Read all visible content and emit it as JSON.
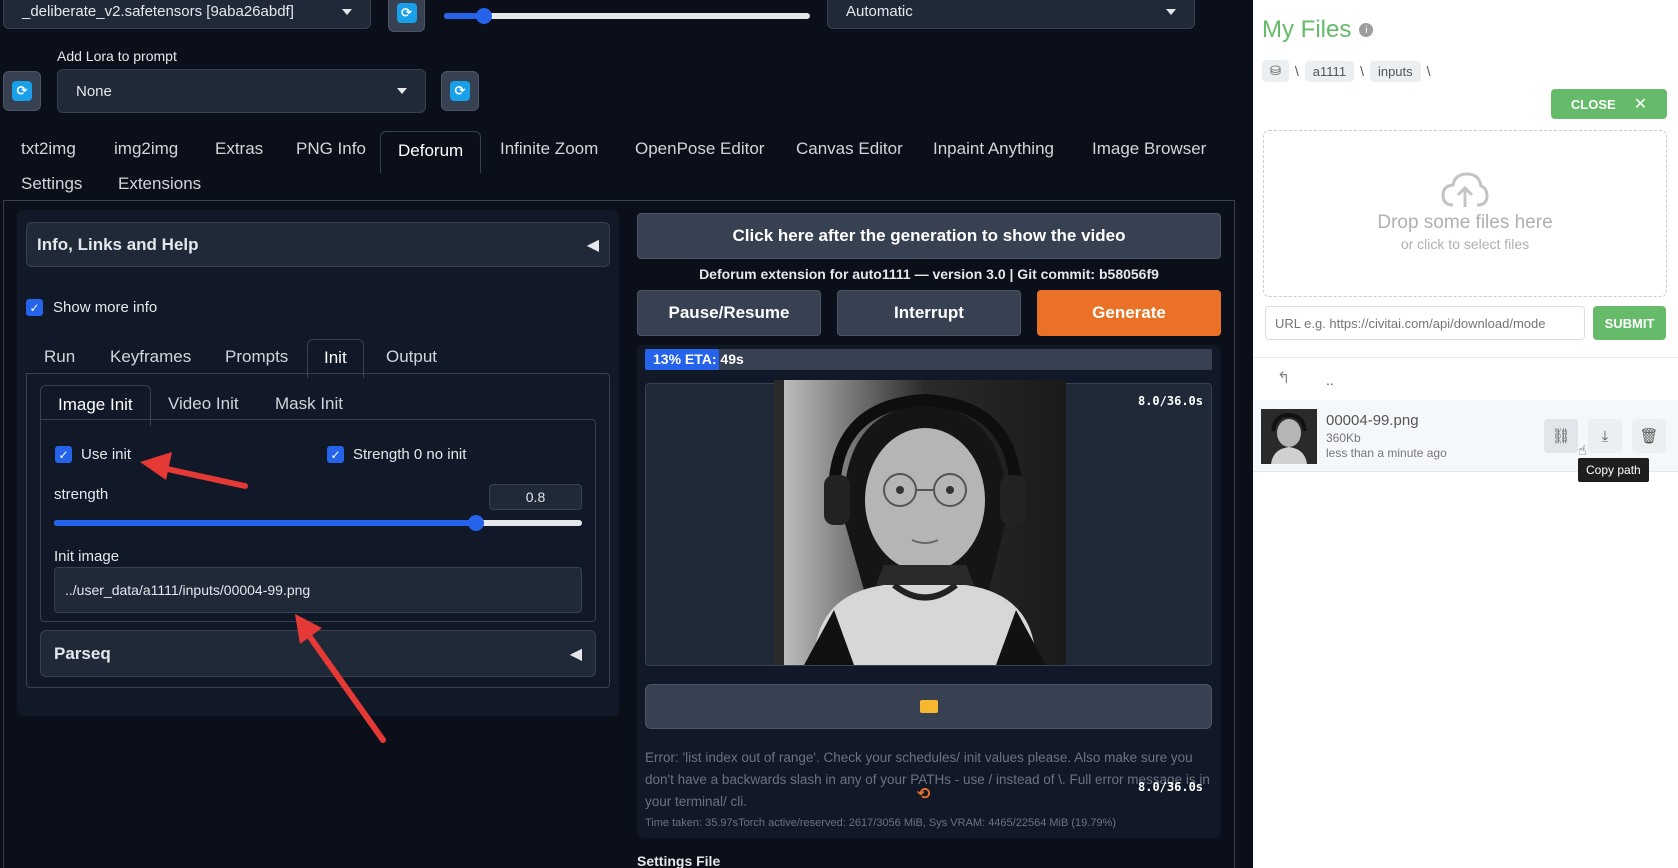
{
  "top": {
    "checkpoint": "_deliberate_v2.safetensors [9aba26abdf]",
    "vae_select": "Automatic",
    "lora_label": "Add Lora to prompt",
    "lora_value": "None"
  },
  "main_tabs": [
    "txt2img",
    "img2img",
    "Extras",
    "PNG Info",
    "Deforum",
    "Infinite Zoom",
    "OpenPose Editor",
    "Canvas Editor",
    "Inpaint Anything",
    "Image Browser",
    "Settings",
    "Extensions"
  ],
  "left": {
    "accordion_info": "Info, Links and Help",
    "show_more_info": "Show more info",
    "sub_tabs": [
      "Run",
      "Keyframes",
      "Prompts",
      "Init",
      "Output"
    ],
    "init_tabs": [
      "Image Init",
      "Video Init",
      "Mask Init"
    ],
    "use_init": "Use init",
    "strength_0": "Strength 0 no init",
    "strength_label": "strength",
    "strength_value": "0.8",
    "strength_fraction": 0.8,
    "init_image_label": "Init image",
    "init_image_value": "../user_data/a1111/inputs/00004-99.png",
    "parseq": "Parseq"
  },
  "center": {
    "show_video_btn": "Click here after the generation to show the video",
    "version_line": "Deforum extension for auto1111 — version 3.0 | Git commit: b58056f9",
    "pause_btn": "Pause/Resume",
    "interrupt_btn": "Interrupt",
    "generate_btn": "Generate",
    "progress_text": "13% ETA: 49s",
    "progress_fraction": 0.13,
    "frame_counter": "8.0/36.0s",
    "frame_counter2": "8.0/36.0s",
    "error_text": "Error: 'list index out of range'. Check your schedules/ init values please. Also make sure you don't have a backwards slash in any of your PATHs - use / instead of \\. Full error message is in your terminal/ cli.",
    "time_taken": "Time taken: 35.97sTorch active/reserved: 2617/3056 MiB, Sys VRAM: 4465/22564 MiB (19.79%)",
    "settings_file": "Settings File"
  },
  "files": {
    "title": "My Files",
    "crumbs": [
      "a1111",
      "inputs"
    ],
    "close_btn": "CLOSE",
    "drop_title": "Drop some files here",
    "drop_sub": "or click to select files",
    "url_placeholder": "URL e.g. https://civitai.com/api/download/mode",
    "submit_btn": "SUBMIT",
    "up_dir": "..",
    "file_name": "00004-99.png",
    "file_size": "360Kb",
    "file_time": "less than a minute ago",
    "tooltip": "Copy path"
  },
  "colors": {
    "accent_blue": "#2563eb",
    "generate_orange": "#ea7125",
    "files_green": "#66bb6a"
  }
}
